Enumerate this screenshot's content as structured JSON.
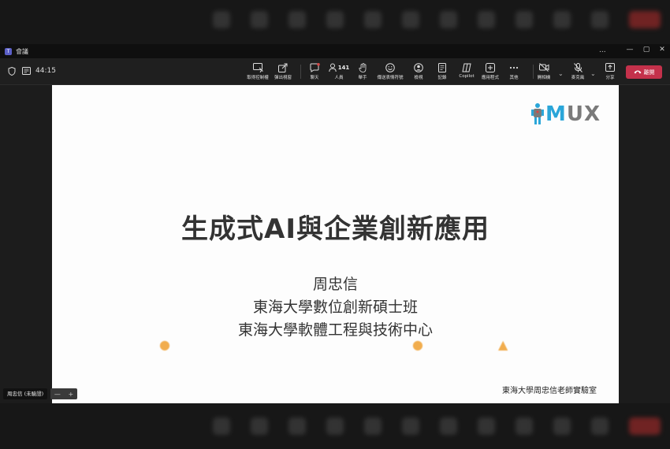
{
  "window": {
    "title": "會議",
    "more_label": "...",
    "minimize_label": "—",
    "maximize_label": "▢",
    "close_label": "✕"
  },
  "meeting": {
    "timer": "44:15"
  },
  "toolbar": {
    "take_control": "取得控制權",
    "popout": "彈出視窗",
    "chat": "聊天",
    "people": "人員",
    "people_count": "141",
    "raise": "舉手",
    "react": "傳送表情符號",
    "view": "檢視",
    "notes": "記錄",
    "copilot": "Copilot",
    "apps": "應用程式",
    "more": "其他",
    "camera": "開相機",
    "mic": "麥克風",
    "share": "分享",
    "leave": "離開"
  },
  "slide": {
    "logo_text": "MUX",
    "title": "生成式AI與企業創新應用",
    "author": "周忠信",
    "affiliation_1": "東海大學數位創新碩士班",
    "affiliation_2": "東海大學軟體工程與技術中心",
    "lab": "東海大學周忠信老師實驗室"
  },
  "presenter": {
    "name_chip": "周忠信 (未驗證)"
  },
  "zoom": {
    "minus": "—",
    "plus": "+"
  },
  "colors": {
    "leave_button": "#c4314b",
    "teams_accent": "#5b5fc7",
    "logo_blue": "#2aa6d9",
    "logo_gray": "#7a7a7a"
  }
}
